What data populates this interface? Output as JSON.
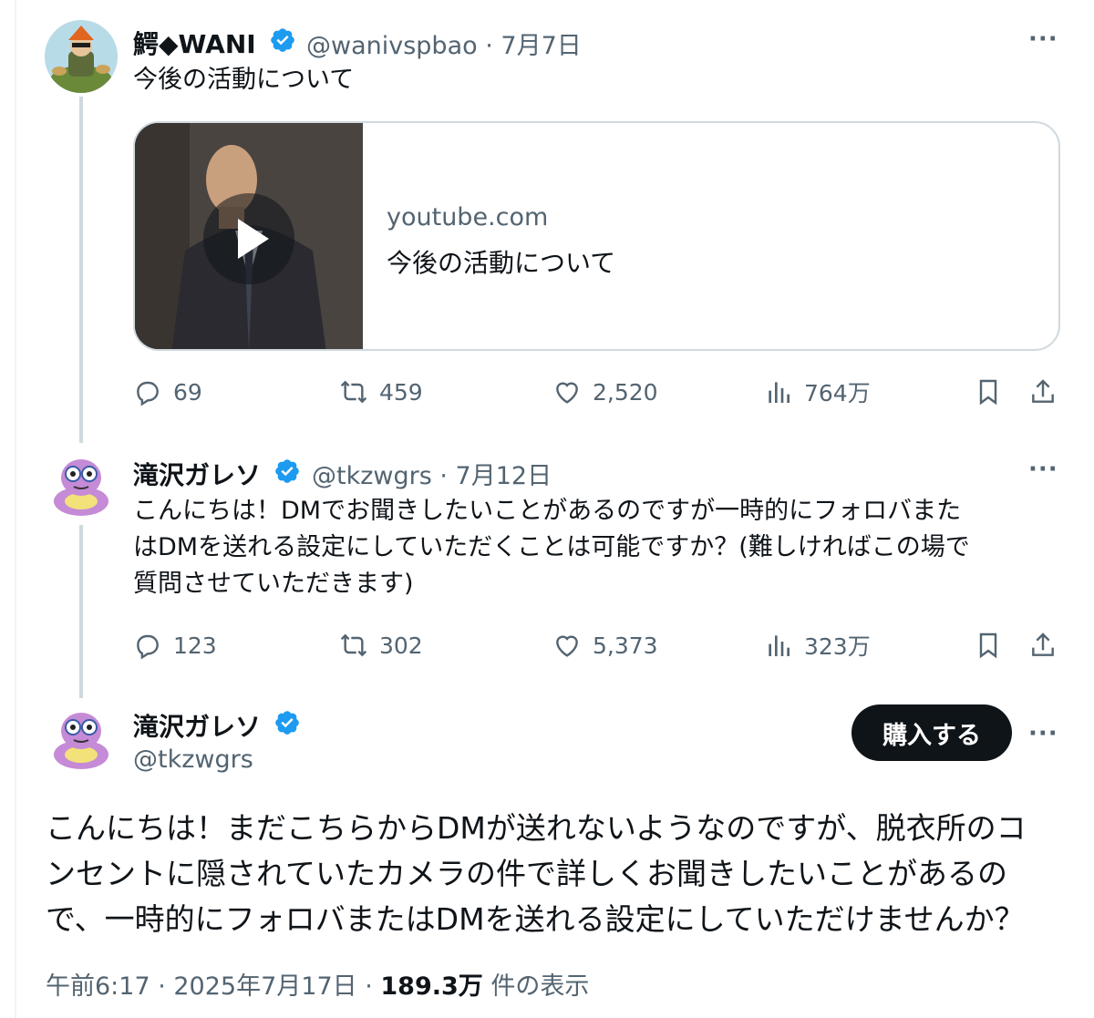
{
  "tweets": [
    {
      "name": "鰐◆WANI",
      "handle": "@wanivspbao",
      "date": "7月7日",
      "text": "今後の活動について",
      "card": {
        "domain": "youtube.com",
        "title": "今後の活動について"
      },
      "stats": {
        "replies": "69",
        "retweets": "459",
        "likes": "2,520",
        "views": "764万"
      }
    },
    {
      "name": "滝沢ガレソ",
      "handle": "@tkzwgrs",
      "date": "7月12日",
      "text_lines": [
        "こんにちは！DMでお聞きしたいことがあるのですが一時的にフォロバまた",
        "はDMを送れる設定にしていただくことは可能ですか？(難しければこの場で",
        "質問させていただきます)"
      ],
      "stats": {
        "replies": "123",
        "retweets": "302",
        "likes": "5,373",
        "views": "323万"
      }
    }
  ],
  "main_tweet": {
    "name": "滝沢ガレソ",
    "handle": "@tkzwgrs",
    "buy_label": "購入する",
    "text_lines": [
      "こんにちは！まだこちらからDMが送れないようなのですが、脱衣所のコ",
      "ンセントに隠されていたカメラの件で詳しくお聞きしたいことがあるの",
      "で、一時的にフォロバまたはDMを送れる設定にしていただけませんか？"
    ],
    "timestamp": "午前6:17 · 2025年7月17日 · ",
    "views_count": "189.3万",
    "views_label": " 件の表示"
  },
  "meta_separator": " · ",
  "more_label": "···",
  "colors": {
    "verified": "#1d9bf0",
    "muted": "#536471",
    "thread_line": "#cfd9de"
  },
  "icons": [
    "reply-icon",
    "retweet-icon",
    "like-icon",
    "views-icon",
    "bookmark-icon",
    "share-icon",
    "verified-badge-icon",
    "play-icon"
  ]
}
